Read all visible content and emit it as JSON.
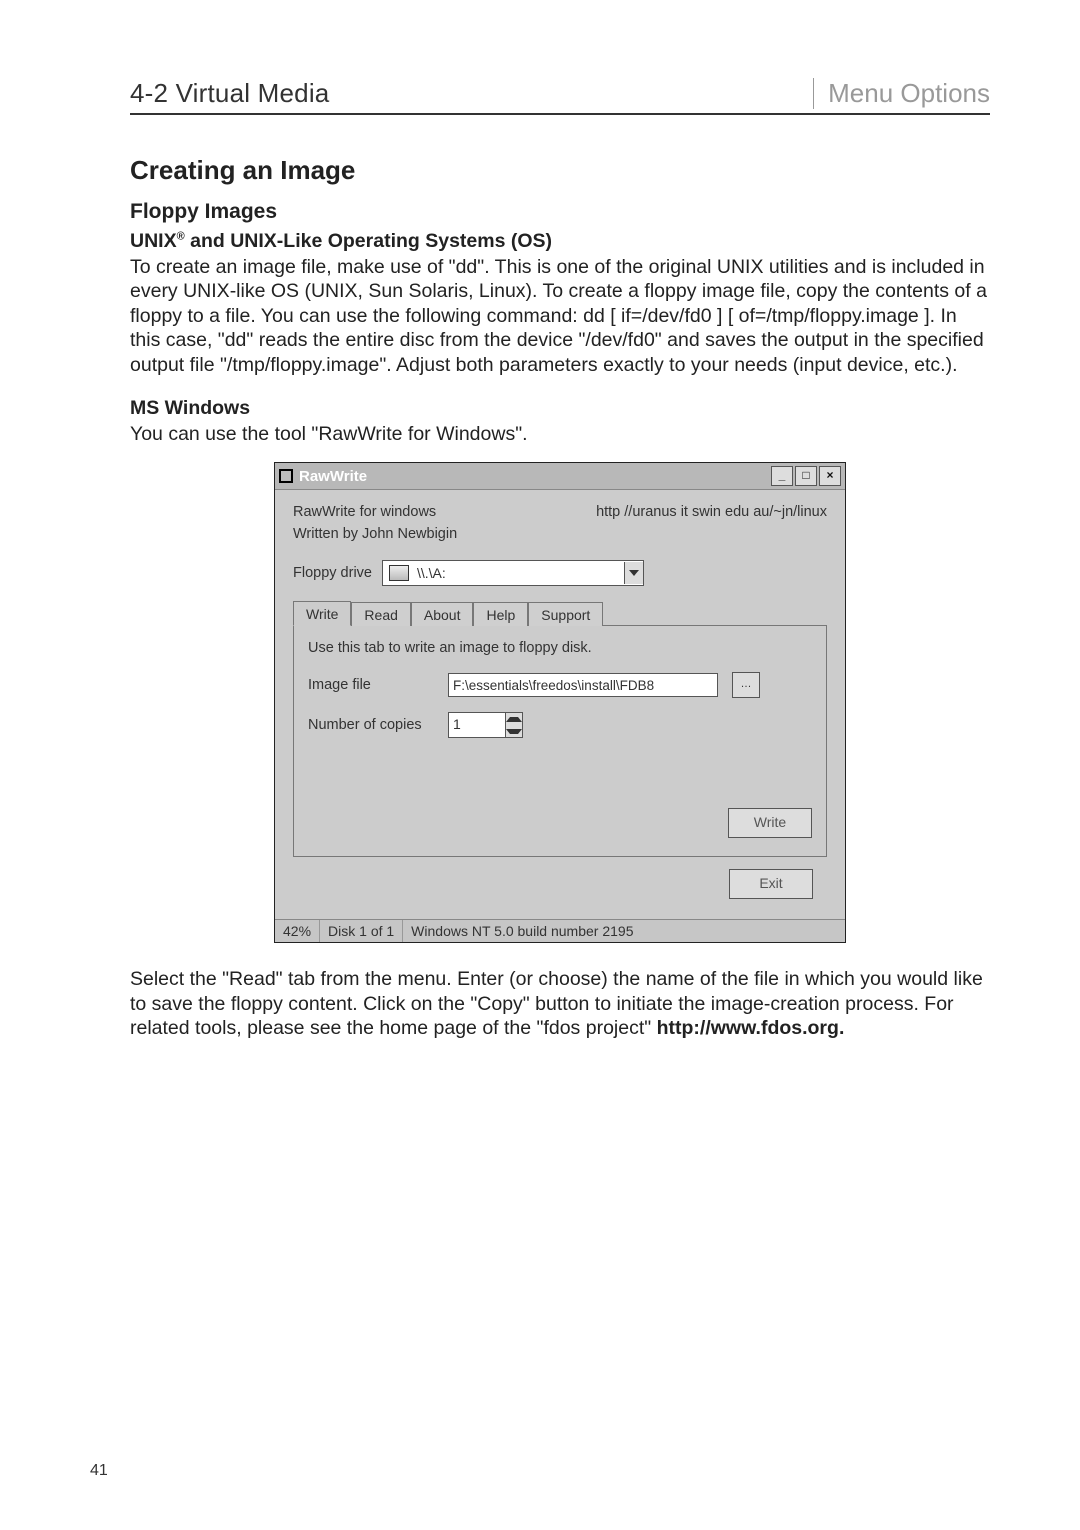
{
  "header": {
    "left": "4-2 Virtual Media",
    "right": "Menu Options"
  },
  "section": {
    "h1": "Creating an Image",
    "h2": "Floppy Images",
    "unix_heading_prefix": "UNIX",
    "unix_heading_suffix": " and UNIX-Like Operating Systems (OS)",
    "reg": "®",
    "unix_body": "To create an image file, make use of \"dd\". This is one of the original UNIX utilities and is included in every UNIX-like OS (UNIX, Sun Solaris, Linux). To create a floppy image file, copy the contents of a floppy to a file. You can use the following command: dd [  if=/dev/fd0  ] [  of=/tmp/floppy.image  ]. In this case, \"dd\" reads the entire disc from the device \"/dev/fd0\" and saves the output in the specified output file \"/tmp/floppy.image\". Adjust both parameters exactly to your needs (input device, etc.).",
    "win_heading": "MS Windows",
    "win_body": "You can use the tool \"RawWrite for Windows\"."
  },
  "rawwrite": {
    "title": "RawWrite",
    "line1_left": "RawWrite for windows",
    "line1_right": "http //uranus it swin edu au/~jn/linux",
    "line2": "Written by John Newbigin",
    "floppy_label": "Floppy drive",
    "floppy_value": "\\\\.\\A:",
    "tabs": [
      "Write",
      "Read",
      "About",
      "Help",
      "Support"
    ],
    "active_tab": 0,
    "tab_hint": "Use this tab to write an image to floppy disk.",
    "image_label": "Image file",
    "image_value": "F:\\essentials\\freedos\\install\\FDB8",
    "copies_label": "Number of copies",
    "copies_value": "1",
    "write_btn": "Write",
    "exit_btn": "Exit",
    "status": {
      "pct": "42%",
      "disk": "Disk 1 of 1",
      "os": "Windows NT 5.0 build number 2195"
    },
    "winbtns": [
      "_",
      "□",
      "×"
    ]
  },
  "after_body_prefix": "Select the \"Read\" tab from the menu. Enter (or choose) the name of the file in which you would like to save the floppy content. Click on the \"Copy\" button to initiate the image-creation process. For related tools, please see the home page of the \"fdos project\" ",
  "after_link": "http://www.fdos.org",
  "after_dot": ".",
  "page_number": "41"
}
